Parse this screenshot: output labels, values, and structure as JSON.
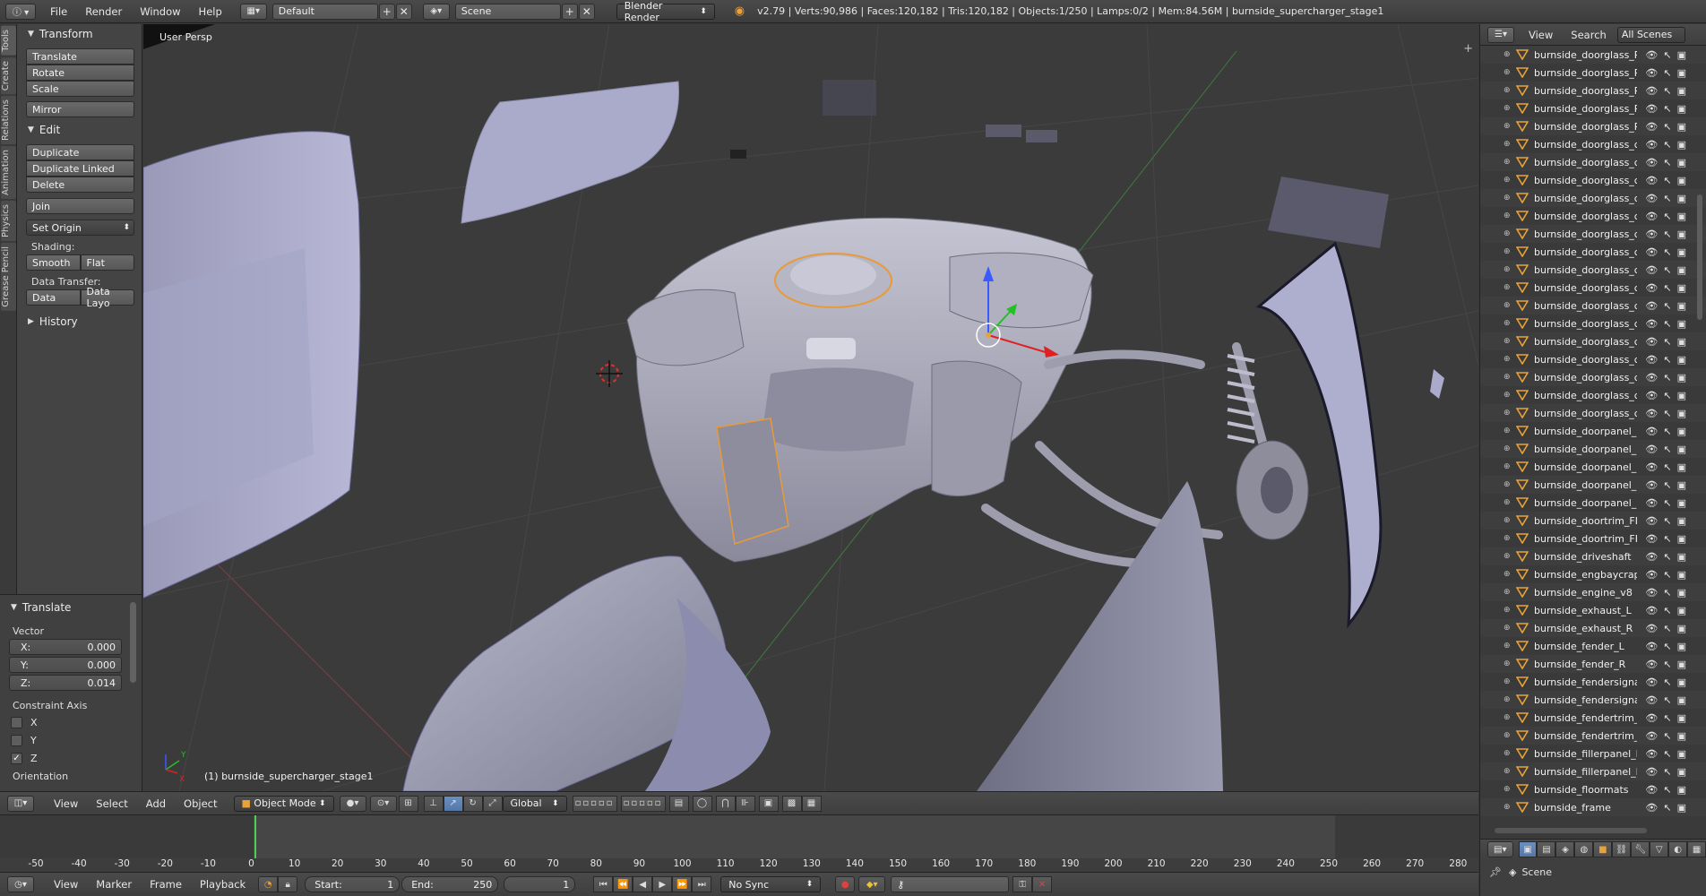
{
  "topbar": {
    "menus": [
      "File",
      "Render",
      "Window",
      "Help"
    ],
    "layout_name": "Default",
    "scene_name": "Scene",
    "render_engine": "Blender Render",
    "stats": "v2.79 | Verts:90,986 | Faces:120,182 | Tris:120,182 | Objects:1/250 | Lamps:0/2 | Mem:84.56M | burnside_supercharger_stage1"
  },
  "tool_tabs": [
    "Tools",
    "Create",
    "Relations",
    "Animation",
    "Physics",
    "Grease Pencil"
  ],
  "toolshelf": {
    "transform_title": "Transform",
    "translate": "Translate",
    "rotate": "Rotate",
    "scale": "Scale",
    "mirror": "Mirror",
    "edit_title": "Edit",
    "duplicate": "Duplicate",
    "duplicate_linked": "Duplicate Linked",
    "delete": "Delete",
    "join": "Join",
    "set_origin": "Set Origin",
    "shading_label": "Shading:",
    "smooth": "Smooth",
    "flat": "Flat",
    "data_transfer_label": "Data Transfer:",
    "data": "Data",
    "data_layout": "Data Layo",
    "history_title": "History"
  },
  "redo_panel": {
    "title": "Translate",
    "vector_label": "Vector",
    "x_label": "X:",
    "x_value": "0.000",
    "y_label": "Y:",
    "y_value": "0.000",
    "z_label": "Z:",
    "z_value": "0.014",
    "constraint_label": "Constraint Axis",
    "axis_x": "X",
    "axis_y": "Y",
    "axis_z": "Z",
    "axis_checked": [
      false,
      false,
      true
    ],
    "orientation_label": "Orientation"
  },
  "viewport": {
    "view_label": "User Persp",
    "object_label": "(1) burnside_supercharger_stage1",
    "axis_y": "Y",
    "axis_x": "X"
  },
  "vp_header": {
    "menus": [
      "View",
      "Select",
      "Add",
      "Object"
    ],
    "mode": "Object Mode",
    "orientation": "Global"
  },
  "timeline": {
    "ticks": [
      "-50",
      "-40",
      "-30",
      "-20",
      "-10",
      "0",
      "10",
      "20",
      "30",
      "40",
      "50",
      "60",
      "70",
      "80",
      "90",
      "100",
      "110",
      "120",
      "130",
      "140",
      "150",
      "160",
      "170",
      "180",
      "190",
      "200",
      "210",
      "220",
      "230",
      "240",
      "250",
      "260",
      "270",
      "280"
    ],
    "current_frame": 1
  },
  "tl_header": {
    "menus": [
      "View",
      "Marker",
      "Frame",
      "Playback"
    ],
    "start_label": "Start:",
    "start_value": "1",
    "end_label": "End:",
    "end_value": "250",
    "current_value": "1",
    "sync": "No Sync"
  },
  "outliner": {
    "menus": [
      "View",
      "Search"
    ],
    "scope": "All Scenes",
    "rows": [
      "burnside_doorglass_RR",
      "burnside_doorglass_RR",
      "burnside_doorglass_RR",
      "burnside_doorglass_RR",
      "burnside_doorglass_RR",
      "burnside_doorglass_ch",
      "burnside_doorglass_ch",
      "burnside_doorglass_ch",
      "burnside_doorglass_ch",
      "burnside_doorglass_ch",
      "burnside_doorglass_ch",
      "burnside_doorglass_ch",
      "burnside_doorglass_ch",
      "burnside_doorglass_ch",
      "burnside_doorglass_ch",
      "burnside_doorglass_ch",
      "burnside_doorglass_ch",
      "burnside_doorglass_ch",
      "burnside_doorglass_ch",
      "burnside_doorglass_ch",
      "burnside_doorglass_ch",
      "burnside_doorpanel_FL",
      "burnside_doorpanel_FL",
      "burnside_doorpanel_FF",
      "burnside_doorpanel_RL",
      "burnside_doorpanel_RF",
      "burnside_doortrim_FL",
      "burnside_doortrim_FR",
      "burnside_driveshaft",
      "burnside_engbaycrap",
      "burnside_engine_v8",
      "burnside_exhaust_L",
      "burnside_exhaust_R",
      "burnside_fender_L",
      "burnside_fender_R",
      "burnside_fendersignal_",
      "burnside_fendersignal_",
      "burnside_fendertrim_L",
      "burnside_fendertrim_R",
      "burnside_fillerpanel_L",
      "burnside_fillerpanel_R",
      "burnside_floormats",
      "burnside_frame"
    ]
  },
  "properties": {
    "scene_label": "Scene"
  },
  "colors": {
    "accent_blue": "#5378a8",
    "frame_cursor": "#4fce4f",
    "mesh_icon": "#e8a23a",
    "selection_outline": "#e89a3a"
  }
}
